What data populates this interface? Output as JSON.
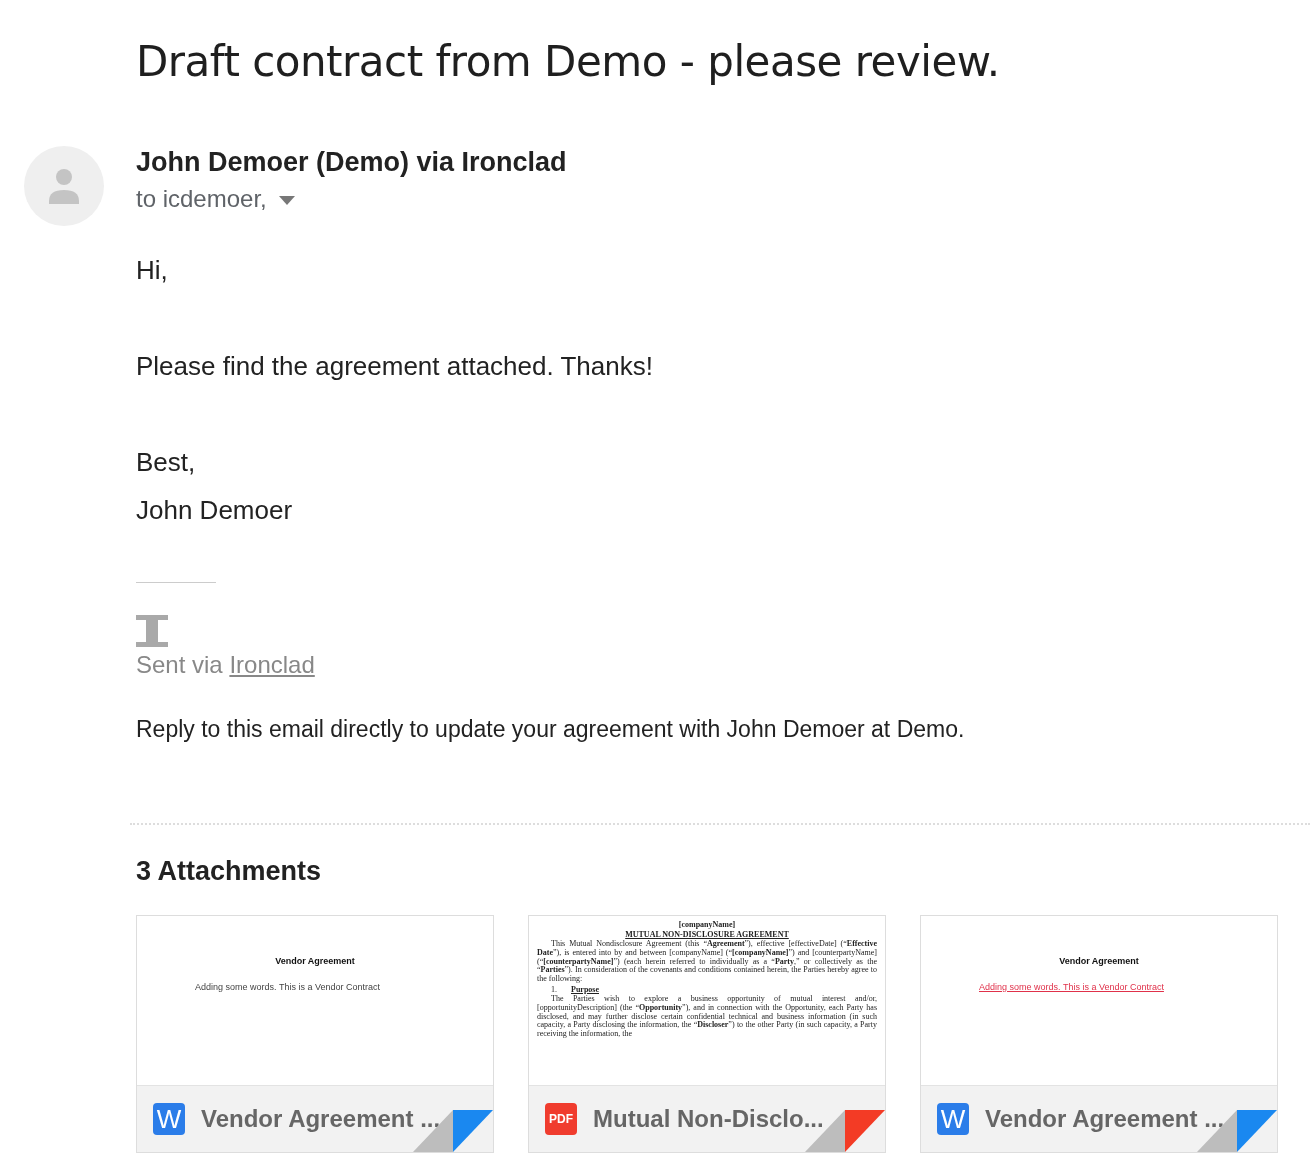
{
  "subject": "Draft contract from Demo - please review.",
  "sender": {
    "name": "John Demoer (Demo) via Ironclad",
    "recipients": "to icdemoer,"
  },
  "body": {
    "paragraphs": [
      [
        "Hi,"
      ],
      [
        "Please find the agreement attached. Thanks!"
      ],
      [
        "Best,",
        "John Demoer"
      ]
    ]
  },
  "signature": {
    "sent_via": "Sent via",
    "link": "Ironclad"
  },
  "note": "Reply to this email directly to update your agreement with John Demoer at Demo.",
  "attachments_heading": "3 Attachments",
  "attachments": [
    {
      "kind": "word",
      "badge": "W",
      "name": "Vendor Agreement ...",
      "preview": {
        "kind": "simple",
        "title": "Vendor Agreement",
        "text": "Adding some words. This is a Vendor Contract",
        "inserted": false
      }
    },
    {
      "kind": "pdf",
      "badge": "PDF",
      "name": "Mutual Non-Disclo...",
      "preview": {
        "kind": "nda",
        "header": "[companyName]",
        "title": "MUTUAL NON-DISCLOSURE AGREEMENT",
        "paragraphs": [
          "This Mutual Nondisclosure Agreement (this “**Agreement**”), effective [effectiveDate] (“**Effective Date**”), is entered into by and between [companyName] (“**[companyName]**”) and [counterpartyName] (“**[counterpartyName]**”) (each herein referred to individually as a “**Party**,” or collectively as the “**Parties**”). In consideration of the covenants and conditions contained herein, the Parties hereby agree to the following:"
        ],
        "section_number": "1.",
        "section_title": "Purpose",
        "section_text": "The Parties wish to explore a business opportunity of mutual interest and/or, [opportunityDescription] (the “**Opportunity**”), and in connection with the Opportunity, each Party has disclosed, and may further disclose certain confidential technical and business information (in such capacity, a Party disclosing the information, the “**Discloser**”) to the other Party (in such capacity, a Party receiving the information, the"
      }
    },
    {
      "kind": "word",
      "badge": "W",
      "name": "Vendor Agreement ...",
      "preview": {
        "kind": "simple",
        "title": "Vendor Agreement",
        "text": "Adding some words. This is a Vendor Contract",
        "inserted": true
      }
    }
  ]
}
